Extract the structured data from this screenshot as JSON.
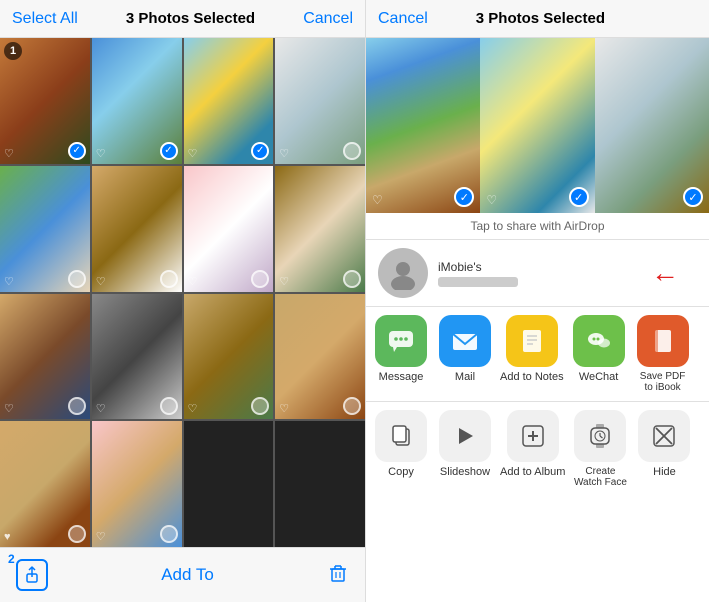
{
  "left_panel": {
    "header": {
      "select_all": "Select All",
      "photos_selected": "3 Photos Selected",
      "cancel": "Cancel"
    },
    "footer": {
      "add_to": "Add To",
      "num2": "2"
    },
    "photos": [
      {
        "id": 1,
        "color": "pc-redhair",
        "checked": true,
        "heart": true,
        "number": 1
      },
      {
        "id": 2,
        "color": "pc-mountain",
        "checked": true,
        "heart": false
      },
      {
        "id": 3,
        "color": "pc-beach",
        "checked": true,
        "heart": false
      },
      {
        "id": 4,
        "color": "pc-snowy",
        "checked": false,
        "heart": false
      },
      {
        "id": 5,
        "color": "pc-landscape",
        "checked": false,
        "heart": false
      },
      {
        "id": 6,
        "color": "pc-dog",
        "checked": false,
        "heart": false
      },
      {
        "id": 7,
        "color": "pc-anime",
        "checked": false,
        "heart": false
      },
      {
        "id": 8,
        "color": "pc-hut",
        "checked": false,
        "heart": false
      },
      {
        "id": 9,
        "color": "pc-woman",
        "checked": false,
        "heart": false
      },
      {
        "id": 10,
        "color": "pc-husky",
        "checked": false,
        "heart": false
      },
      {
        "id": 11,
        "color": "pc-bigdog",
        "checked": false,
        "heart": false
      },
      {
        "id": 12,
        "color": "pc-smalldog",
        "checked": false,
        "heart": false
      },
      {
        "id": 13,
        "color": "pc-puppy",
        "checked": false,
        "heart": true
      },
      {
        "id": 14,
        "color": "pc-girl",
        "checked": false,
        "heart": false
      }
    ]
  },
  "right_panel": {
    "header": {
      "cancel": "Cancel",
      "title": "3 Photos Selected"
    },
    "airdrop_hint": "Tap to share with AirDrop",
    "contact": {
      "name": "iMobie's"
    },
    "share_apps": [
      {
        "id": "message",
        "label": "Message",
        "icon": "💬",
        "bg": "app-message"
      },
      {
        "id": "mail",
        "label": "Mail",
        "icon": "✉️",
        "bg": "app-mail"
      },
      {
        "id": "notes",
        "label": "Add to Notes",
        "icon": "📝",
        "bg": "app-notes"
      },
      {
        "id": "wechat",
        "label": "WeChat",
        "icon": "💬",
        "bg": "app-wechat"
      },
      {
        "id": "savepdf",
        "label": "Save PDF to iBook",
        "icon": "📖",
        "bg": "app-savepdf"
      }
    ],
    "actions": [
      {
        "id": "copy",
        "label": "Copy",
        "icon": "⧉"
      },
      {
        "id": "slideshow",
        "label": "Slideshow",
        "icon": "▶"
      },
      {
        "id": "add-album",
        "label": "Add to Album",
        "icon": "⊞"
      },
      {
        "id": "watch-face",
        "label": "Create Watch Face",
        "icon": "⌚"
      },
      {
        "id": "hide",
        "label": "Hide",
        "icon": "⊘"
      }
    ]
  }
}
